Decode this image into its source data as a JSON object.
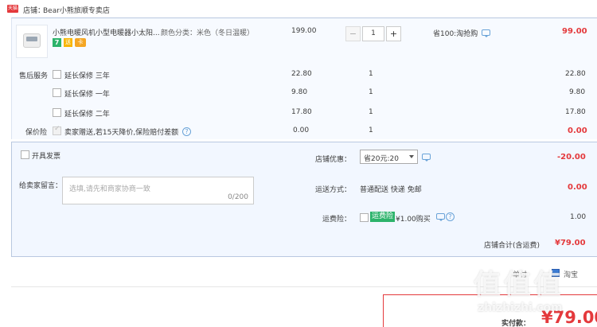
{
  "shop": {
    "badge": "天猫",
    "label": "店铺：",
    "name": "Bear小熊旅顺专卖店"
  },
  "product": {
    "title": "小熊电暖风机小型电暖器小太阳...",
    "sku": "颜色分类：米色（冬日温暖）",
    "price": "199.00",
    "qty": "1",
    "minus": "−",
    "plus": "+",
    "promo": "省100:淘抢购",
    "subtotal": "99.00",
    "badges": [
      "7",
      "送",
      "卡"
    ]
  },
  "aftersale": {
    "label": "售后服务",
    "options": [
      {
        "label": "延长保修 三年",
        "price": "22.80",
        "qty": "1",
        "total": "22.80"
      },
      {
        "label": "延长保修 一年",
        "price": "9.80",
        "qty": "1",
        "total": "9.80"
      },
      {
        "label": "延长保修 二年",
        "price": "17.80",
        "qty": "1",
        "total": "17.80"
      }
    ]
  },
  "insurance": {
    "label": "保价险",
    "text": "卖家赠送,若15天降价,保险赔付差额",
    "price": "0.00",
    "qty": "1",
    "total": "0.00"
  },
  "invoice": {
    "label": "开具发票"
  },
  "message": {
    "label": "给卖家留言：",
    "placeholder": "选填,请先和商家协商一致",
    "counter": "0/200"
  },
  "discount": {
    "label": "店铺优惠：",
    "selected": "省20元:20",
    "amount": "-20.00"
  },
  "shipping": {
    "label": "运送方式：",
    "method": "普通配送 快递 免邮",
    "amount": "0.00"
  },
  "freight_ins": {
    "label": "运费险：",
    "tag": "运费险",
    "text": "¥1.00购买",
    "amount": "1.00"
  },
  "store_total": {
    "label": "店铺合计(含运费)",
    "amount": "¥79.00"
  },
  "footer": {
    "left_text": "单付",
    "right_text": "淘宝",
    "pay_label": "实付款：",
    "pay_amount": "¥79.00",
    "watermark": "值 值 值",
    "watermark_site": "zhizhizhi.com"
  },
  "colors": {
    "accent": "#e4393c",
    "panel_bg": "#f2f7ff",
    "panel_border": "#b9c8e0",
    "link": "#6aa3d8",
    "tag_green": "#2db36b"
  }
}
